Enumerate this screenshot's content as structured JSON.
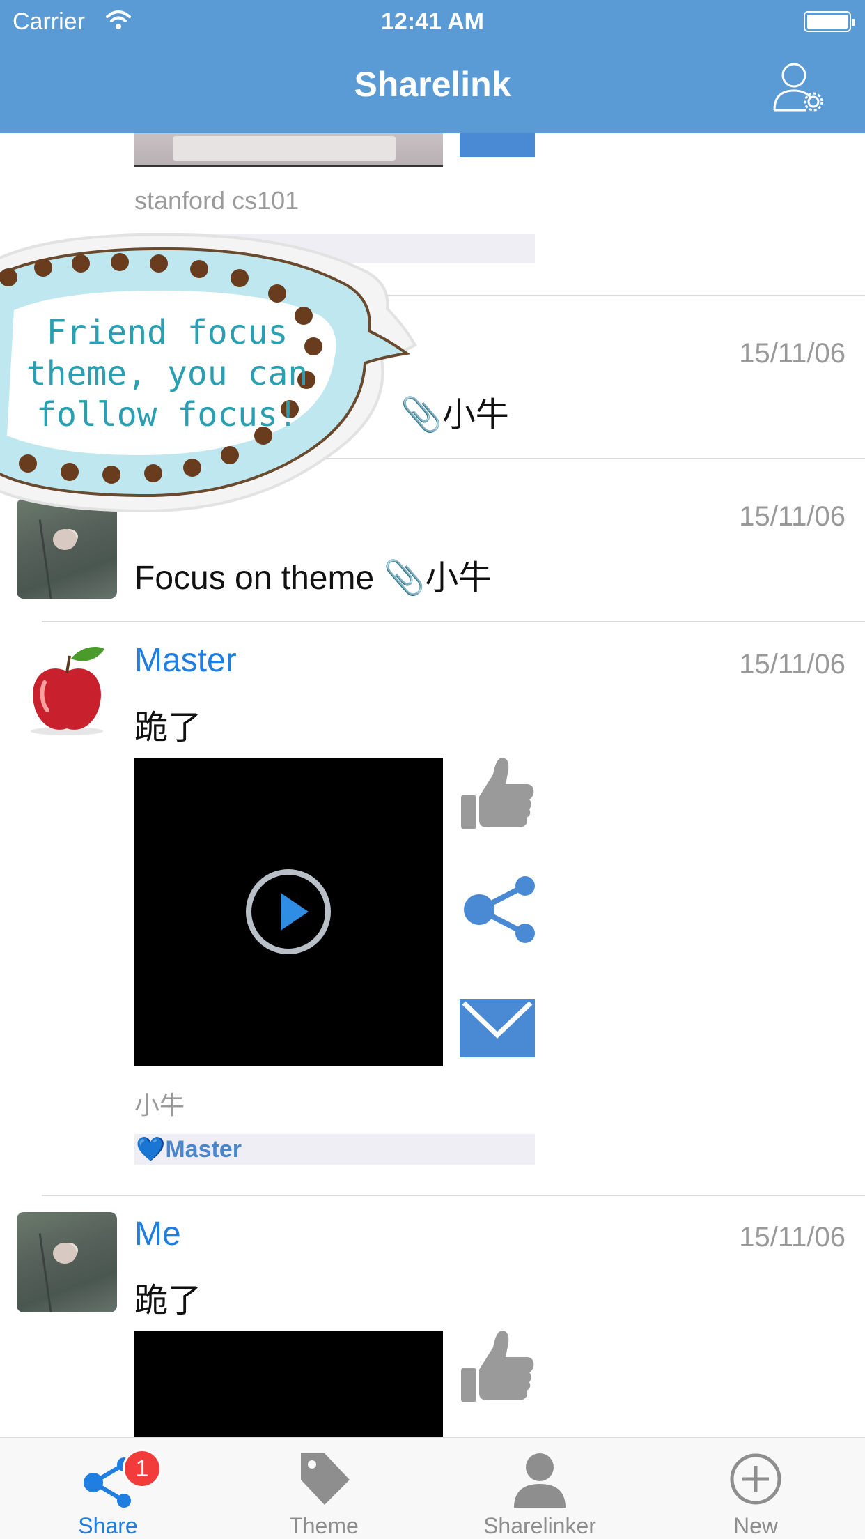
{
  "status_bar": {
    "carrier": "Carrier",
    "time": "12:41 AM"
  },
  "nav": {
    "title": "Sharelink"
  },
  "overlay": {
    "lines": [
      "Friend focus",
      "theme, you can",
      "follow focus!"
    ]
  },
  "posts": [
    {
      "caption": "stanford cs101"
    },
    {
      "date": "15/11/06",
      "message_tag": "小牛"
    },
    {
      "date": "15/11/06",
      "message": "Focus on theme ",
      "message_tag": "小牛"
    },
    {
      "user": "Master",
      "date": "15/11/06",
      "message": "跪了",
      "caption": "小牛",
      "tag": "💙Master"
    },
    {
      "user": "Me",
      "date": "15/11/06",
      "message": "跪了"
    }
  ],
  "tabs": [
    {
      "label": "Share",
      "icon": "share-icon",
      "active": true,
      "badge": "1"
    },
    {
      "label": "Theme",
      "icon": "tag-icon"
    },
    {
      "label": "Sharelinker",
      "icon": "person-icon"
    },
    {
      "label": "New",
      "icon": "plus-circle-icon"
    }
  ],
  "colors": {
    "nav_bg": "#5b9bd5",
    "accent": "#1f7ee0",
    "badge": "#f23c3c"
  }
}
